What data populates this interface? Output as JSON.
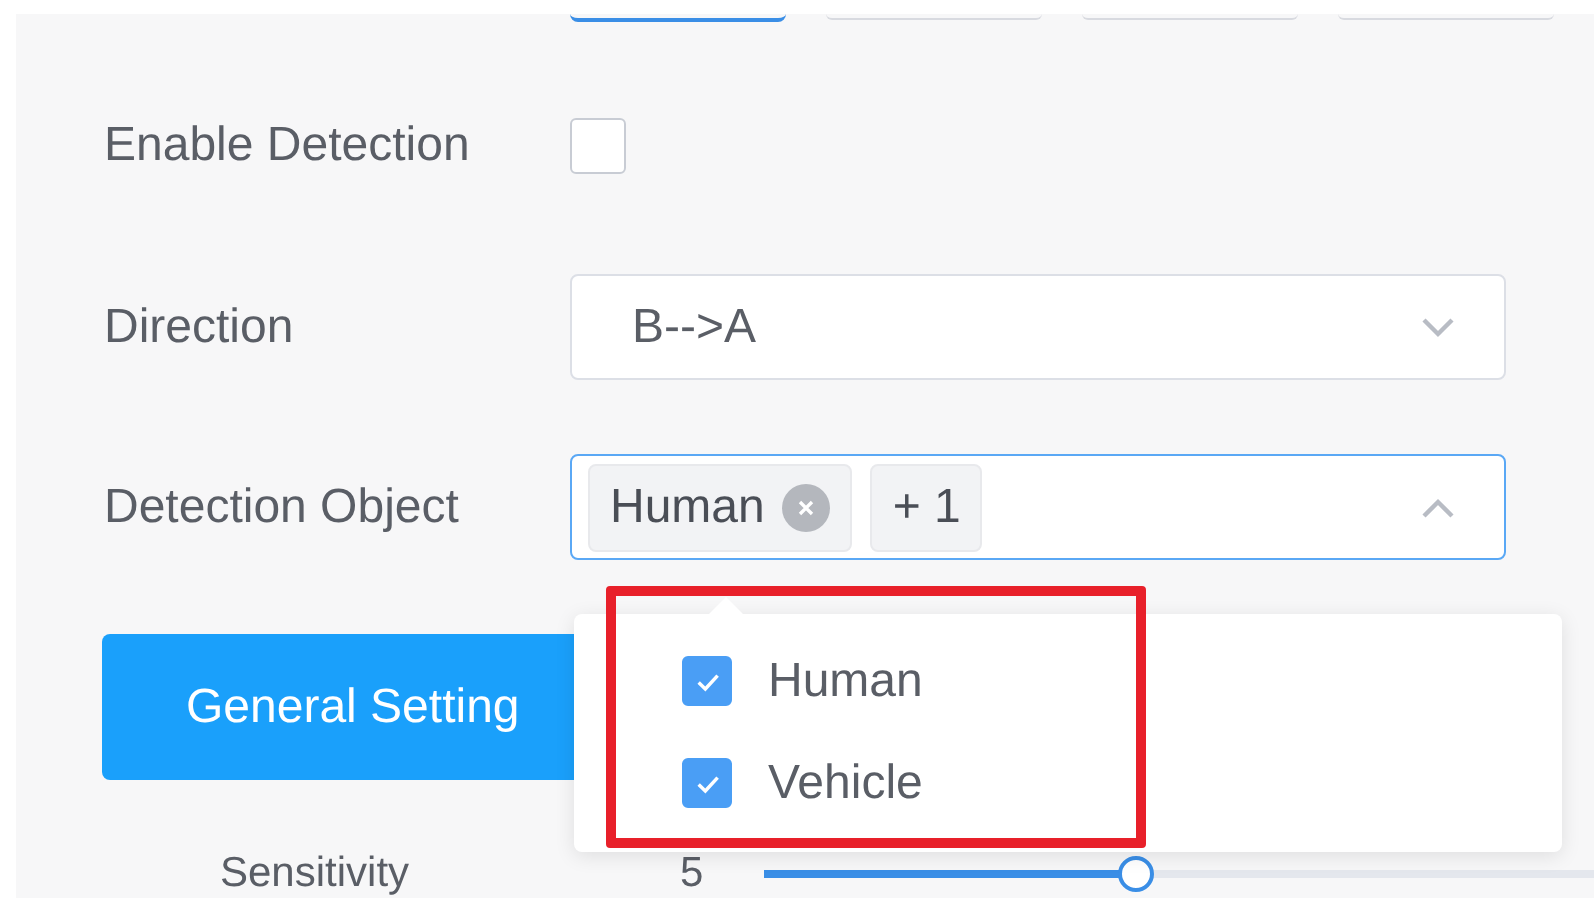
{
  "top_options": [
    {
      "selected": true
    },
    {
      "selected": false
    },
    {
      "selected": false
    },
    {
      "selected": false
    }
  ],
  "enable_detection": {
    "label": "Enable Detection",
    "checked": false
  },
  "direction": {
    "label": "Direction",
    "value": "B-->A",
    "expanded": false
  },
  "detection_object": {
    "label": "Detection Object",
    "expanded": true,
    "tags": [
      {
        "text": "Human",
        "kind": "removable"
      },
      {
        "text": "+ 1",
        "kind": "count"
      }
    ],
    "options": [
      {
        "label": "Human",
        "checked": true
      },
      {
        "label": "Vehicle",
        "checked": true
      }
    ],
    "highlighted": true
  },
  "general_settings": {
    "label": "General Setting"
  },
  "sensitivity": {
    "label": "Sensitivity",
    "value": "5",
    "level": 0.45
  }
}
